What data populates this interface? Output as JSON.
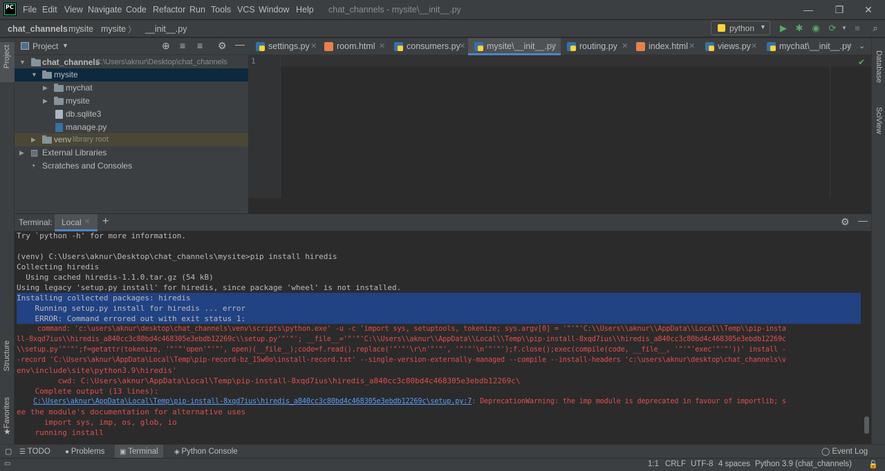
{
  "app": {
    "logo_text": "PC",
    "window_title": "chat_channels - mysite\\__init__.py"
  },
  "menu": [
    "File",
    "Edit",
    "View",
    "Navigate",
    "Code",
    "Refactor",
    "Run",
    "Tools",
    "VCS",
    "Window",
    "Help"
  ],
  "window_controls": {
    "minimize": "—",
    "maximize": "❐",
    "close": "✕"
  },
  "breadcrumb": [
    "chat_channels",
    "mysite",
    "mysite",
    "__init__.py"
  ],
  "toolbar": {
    "run_config": "python"
  },
  "project_panel": {
    "title": "Project",
    "tree": [
      {
        "label": "chat_channels",
        "hint": "C:\\Users\\aknur\\Desktop\\chat_channels"
      },
      {
        "label": "mysite"
      },
      {
        "label": "mychat"
      },
      {
        "label": "mysite"
      },
      {
        "label": "db.sqlite3"
      },
      {
        "label": "manage.py"
      },
      {
        "label": "venv",
        "hint": "library root"
      },
      {
        "label": "External Libraries"
      },
      {
        "label": "Scratches and Consoles"
      }
    ]
  },
  "editor_tabs": [
    "settings.py",
    "room.html",
    "consumers.py",
    "mysite\\__init__.py",
    "routing.py",
    "index.html",
    "views.py",
    "mychat\\__init__.py"
  ],
  "editor": {
    "line_number": "1"
  },
  "side_labels": {
    "project": "Project",
    "structure": "Structure",
    "favorites": "Favorites",
    "database": "Database",
    "sciview": "SciView"
  },
  "terminal": {
    "label": "Terminal:",
    "tab": "Local",
    "lines": [
      "Try `python -h' for more information.",
      "",
      "(venv) C:\\Users\\aknur\\Desktop\\chat_channels\\mysite>pip install hiredis",
      "Collecting hiredis",
      "  Using cached hiredis-1.1.0.tar.gz (54 kB)",
      "Using legacy 'setup.py install' for hiredis, since package 'wheel' is not installed.",
      "Installing collected packages: hiredis",
      "    Running setup.py install for hiredis ... error",
      "    ERROR: Command errored out with exit status 1:",
      "     command: 'c:\\users\\aknur\\desktop\\chat_channels\\venv\\scripts\\python.exe' -u -c 'import sys, setuptools, tokenize; sys.argv[0] = '\"'\"'C:\\\\Users\\\\aknur\\\\AppData\\\\Local\\\\Temp\\\\pip-insta",
      "ll-8xqd7ius\\\\hiredis_a840cc3c80bd4c468305e3ebdb12269c\\\\setup.py'\"'\"'; __file__='\"'\"'C:\\\\Users\\\\aknur\\\\AppData\\\\Local\\\\Temp\\\\pip-install-8xqd7ius\\\\hiredis_a840cc3c80bd4c468305e3ebdb12269c",
      "\\\\setup.py'\"'\"';f=getattr(tokenize, '\"'\"'open'\"'\"', open)(__file__);code=f.read().replace('\"'\"'\\r\\n'\"'\"', '\"'\"'\\n'\"'\"');f.close();exec(compile(code, __file__, '\"'\"'exec'\"'\"'))' install -",
      "-record 'C:\\Users\\aknur\\AppData\\Local\\Temp\\pip-record-bz_15w0o\\install-record.txt' --single-version-externally-managed --compile --install-headers 'c:\\users\\aknur\\desktop\\chat_channels\\v",
      "env\\include\\site\\python3.9\\hiredis'",
      "         cwd: C:\\Users\\aknur\\AppData\\Local\\Temp\\pip-install-8xqd7ius\\hiredis_a840cc3c80bd4c468305e3ebdb12269c\\",
      "    Complete output (13 lines):",
      "",
      "ee the module's documentation for alternative uses",
      "      import sys, imp, os, glob, io",
      "    running install"
    ],
    "link_line": {
      "prefix": "    ",
      "link": "C:\\Users\\aknur\\AppData\\Local\\Temp\\pip-install-8xqd7ius\\hiredis_a840cc3c80bd4c468305e3ebdb12269c\\setup.py:7",
      "suffix": ": DeprecationWarning: the imp module is deprecated in favour of importlib; s"
    }
  },
  "bottom_tools": [
    "TODO",
    "Problems",
    "Terminal",
    "Python Console",
    "Event Log"
  ],
  "statusbar": {
    "position": "1:1",
    "line_sep": "CRLF",
    "encoding": "UTF-8",
    "indent": "4 spaces",
    "interpreter": "Python 3.9 (chat_channels)"
  }
}
